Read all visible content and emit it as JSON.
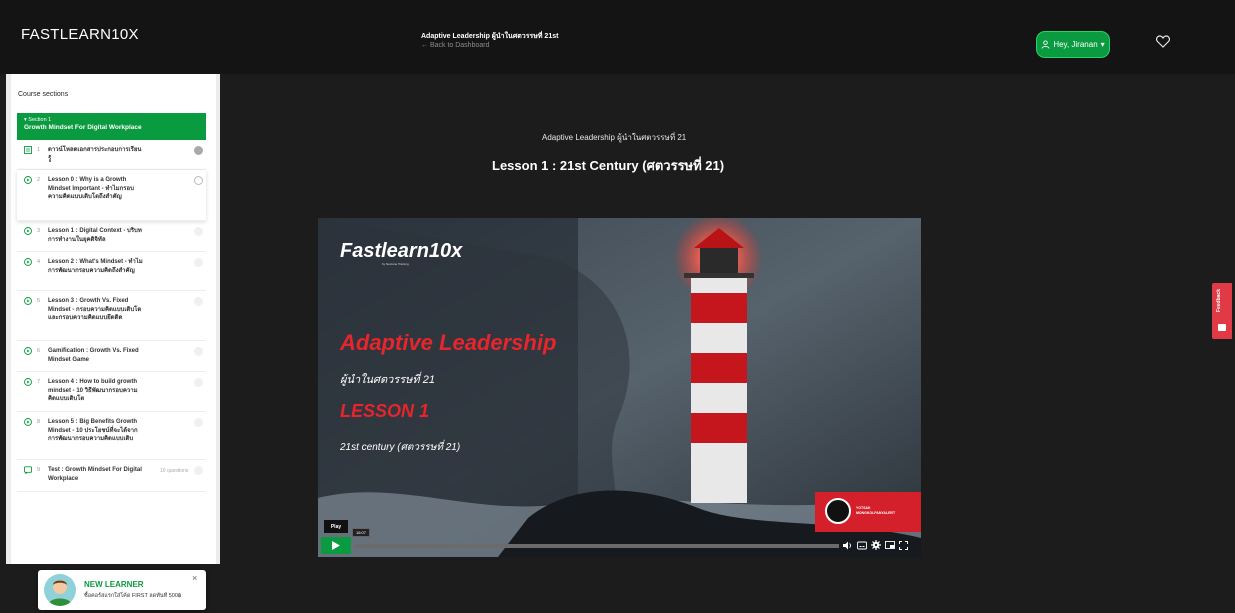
{
  "header": {
    "logo": "FASTLEARN10X",
    "course_title": "Adaptive Leadership ผู้นำในศตวรรษที่ 21st",
    "back_link": "← Back to Dashboard",
    "user_button": "Hey, Jiranan",
    "user_caret": "▾"
  },
  "sidebar": {
    "heading": "Course sections",
    "section": {
      "label": "▾ Section 1",
      "title": "Growth Mindset For Digital Workplace"
    },
    "lessons": [
      {
        "num": "1",
        "title": "ดาวน์โหลดเอกสารประกอบการเรียนรู้",
        "status": "done"
      },
      {
        "num": "2",
        "title": "Lesson 0 : Why is a Growth Mindset Important - ทำไมกรอบความคิดแบบเติบโตถึงสำคัญ",
        "status": "current"
      },
      {
        "num": "3",
        "title": "Lesson 1 : Digital Context - บริบทการทำงานในยุคดิจิทัล",
        "status": "todo"
      },
      {
        "num": "4",
        "title": "Lesson 2 : What's Mindset - ทำไมการพัฒนากรอบความคิดถึงสำคัญ",
        "status": "todo"
      },
      {
        "num": "5",
        "title": "Lesson 3 : Growth Vs. Fixed Mindset - กรอบความคิดแบบเติบโตและกรอบความคิดแบบยึดติด",
        "status": "todo"
      },
      {
        "num": "6",
        "title": "Gamification : Growth Vs. Fixed Mindset Game",
        "status": "todo"
      },
      {
        "num": "7",
        "title": "Lesson 4 : How to build growth mindset - 10 วิธีพัฒนากรอบความคิดแบบเติบโต",
        "status": "todo"
      },
      {
        "num": "8",
        "title": "Lesson 5 : Big Benefits Growth Mindset - 10 ประโยชน์ที่จะได้จากการพัฒนากรอบความคิดแบบเติบ",
        "status": "todo"
      },
      {
        "num": "9",
        "title": "Test : Growth Mindset For Digital Workplace",
        "status": "todo",
        "meta": "10 questions"
      }
    ]
  },
  "promo": {
    "title": "NEW LEARNER",
    "text": "ซื้อคอร์สแรกใส่โค้ด FIRST ลดทันที 500฿",
    "close": "×"
  },
  "main": {
    "subtitle": "Adaptive Leadership ผู้นำในศตวรรษที่ 21",
    "lesson_title": "Lesson 1 : 21st Century (ศตวรรษที่ 21)"
  },
  "video": {
    "brand": "Fastlearn10x",
    "brand_sub": "by Nextone Training",
    "title": "Adaptive Leadership",
    "title_thai": "ผู้นำในศตวรรษที่ 21",
    "lesson": "LESSON 1",
    "lesson_sub": "21st century (ศตวรรษที่ 21)",
    "presenter_name": "YOTSAK\nMONGKOLPANYALERT",
    "play_tooltip": "Play",
    "time_tooltip": "16:07",
    "progress_fraction": 0.0,
    "accent": "#0a9a3f",
    "red": "#e8242c"
  },
  "feedback": {
    "label": "Feedback"
  }
}
